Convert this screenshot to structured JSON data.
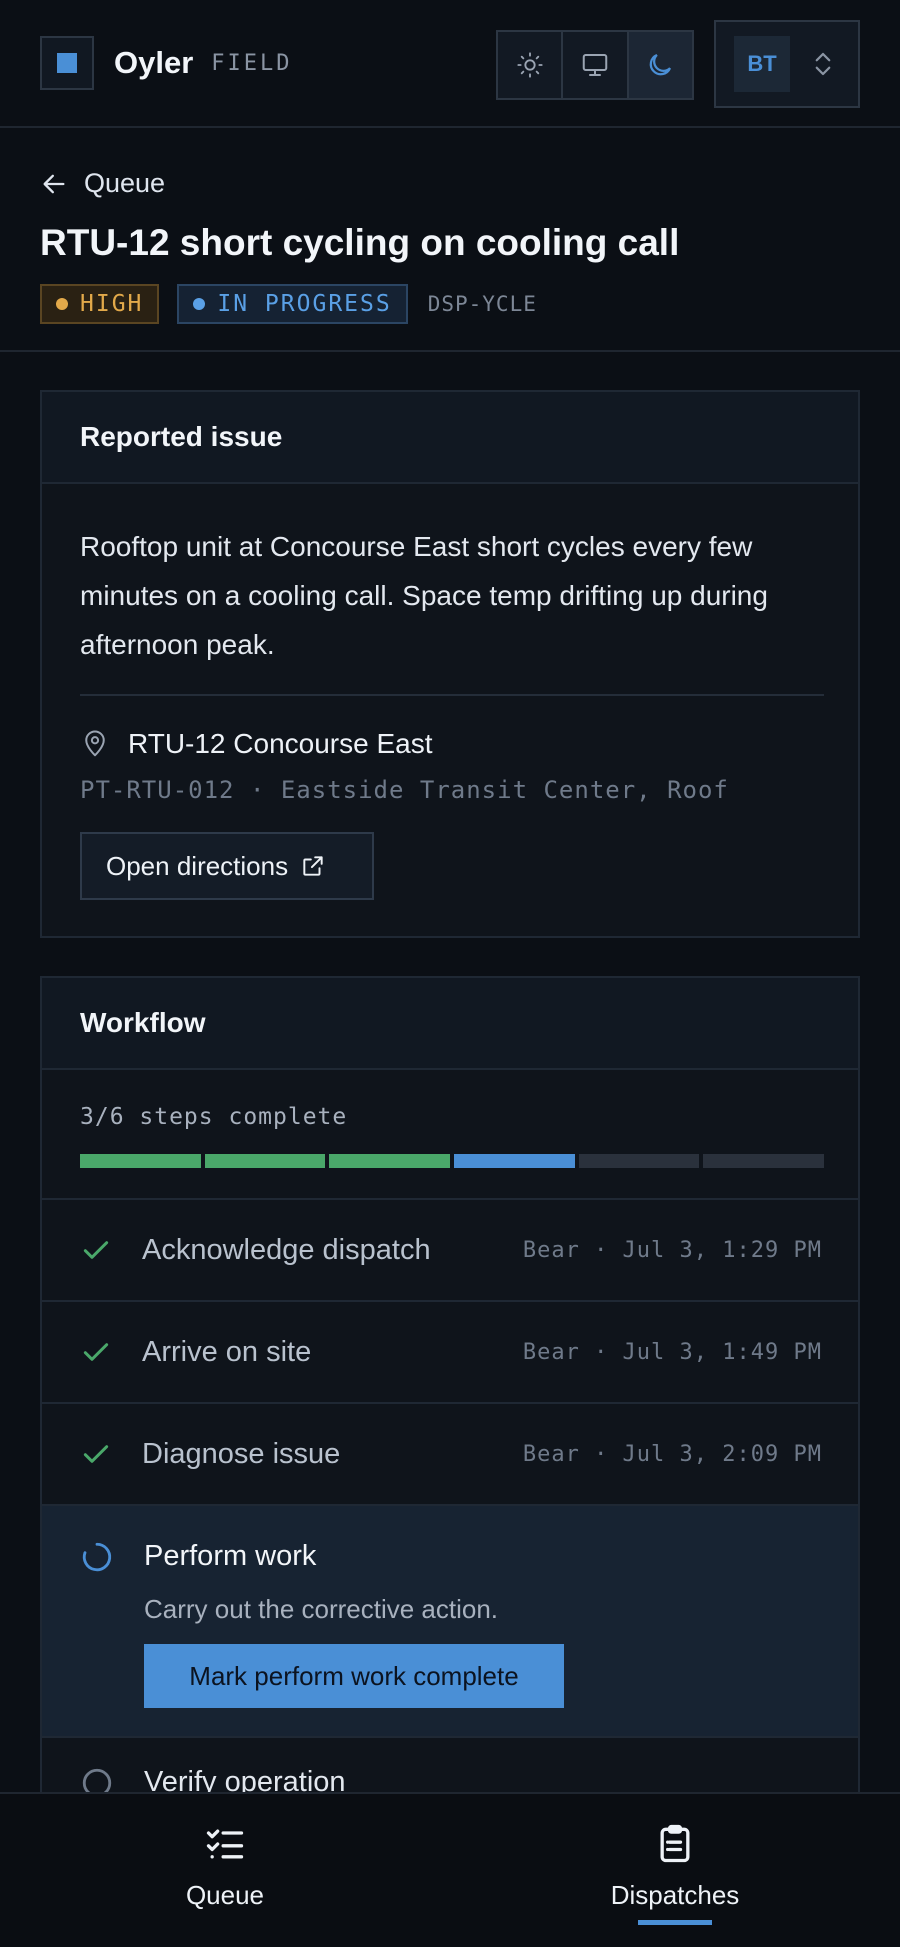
{
  "header": {
    "brand": "Oyler",
    "brand_sub": "FIELD",
    "user_initials": "BT"
  },
  "title_area": {
    "back_label": "Queue",
    "title": "RTU-12 short cycling on cooling call",
    "priority": "HIGH",
    "status": "IN PROGRESS",
    "dispatch_code": "DSP-YCLE"
  },
  "issue_card": {
    "heading": "Reported issue",
    "description": "Rooftop unit at Concourse East short cycles every few minutes on a cooling call. Space temp drifting up during afternoon peak.",
    "location_name": "RTU-12 Concourse East",
    "location_detail": "PT-RTU-012 · Eastside Transit Center, Roof",
    "directions_label": "Open directions"
  },
  "workflow_card": {
    "heading": "Workflow",
    "progress_text": "3/6 steps complete",
    "progress_completed": 3,
    "progress_total": 6,
    "steps": [
      {
        "label": "Acknowledge dispatch",
        "meta": "Bear · Jul 3, 1:29 PM",
        "state": "done"
      },
      {
        "label": "Arrive on site",
        "meta": "Bear · Jul 3, 1:49 PM",
        "state": "done"
      },
      {
        "label": "Diagnose issue",
        "meta": "Bear · Jul 3, 2:09 PM",
        "state": "done"
      },
      {
        "label": "Perform work",
        "description": "Carry out the corrective action.",
        "action_label": "Mark perform work complete",
        "state": "active"
      },
      {
        "label": "Verify operation",
        "state": "todo"
      }
    ]
  },
  "bottom_nav": {
    "queue_label": "Queue",
    "dispatches_label": "Dispatches"
  },
  "colors": {
    "accent": "#4a8fd6",
    "success": "#4aa86a",
    "warning": "#e2a94a",
    "background": "#0b0f15"
  }
}
